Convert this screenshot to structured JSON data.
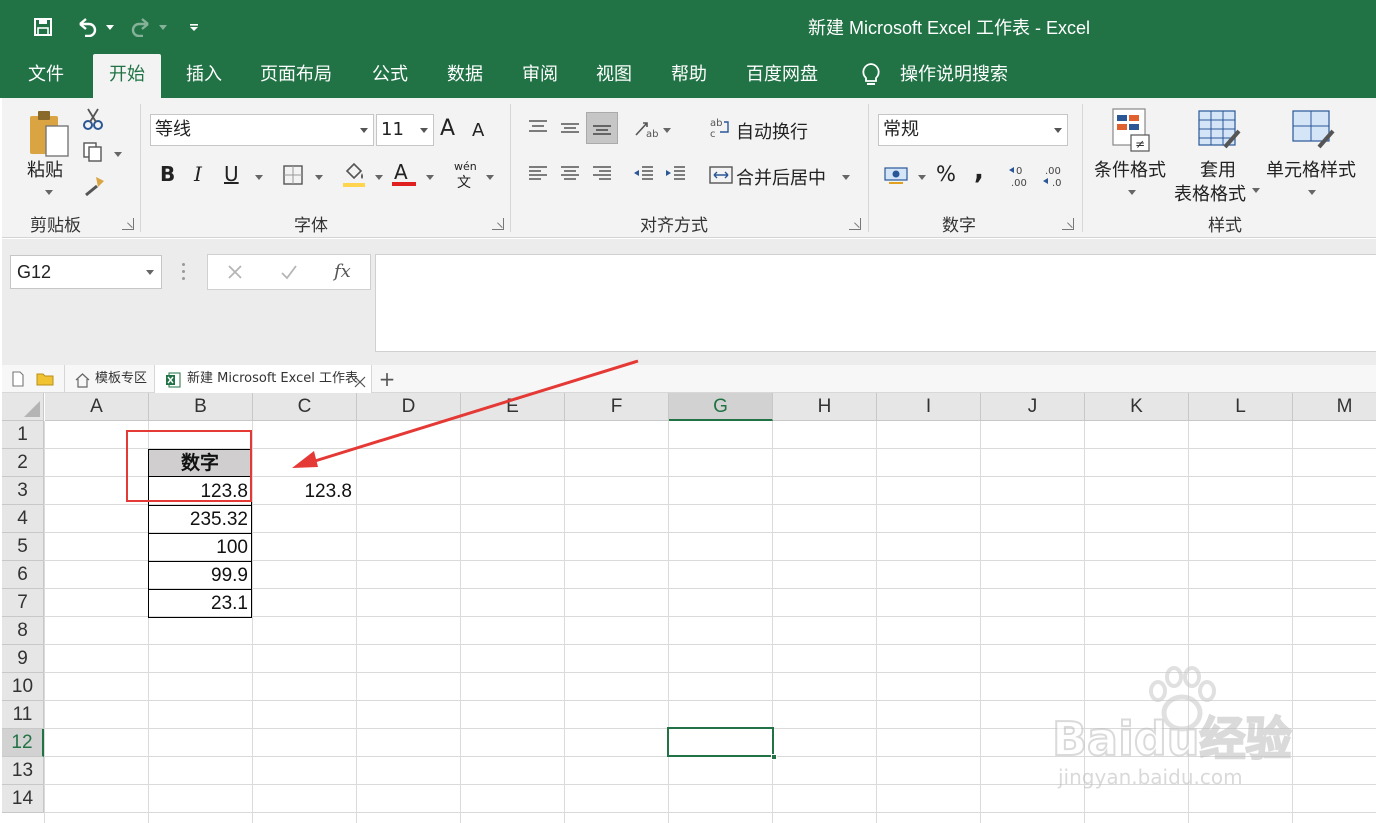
{
  "window": {
    "title": "新建 Microsoft Excel 工作表  -  Excel"
  },
  "quick_access": {
    "save_icon": "save-icon",
    "undo_icon": "undo-icon",
    "redo_icon": "redo-icon",
    "customize_icon": "customize-qat-icon"
  },
  "tabs": [
    "文件",
    "开始",
    "插入",
    "页面布局",
    "公式",
    "数据",
    "审阅",
    "视图",
    "帮助",
    "百度网盘"
  ],
  "tell_me": "操作说明搜索",
  "ribbon": {
    "clipboard": {
      "paste_label": "粘贴",
      "group_label": "剪贴板"
    },
    "font": {
      "font_name": "等线",
      "font_size": "11",
      "grow_label": "A",
      "shrink_label": "A",
      "bold": "B",
      "italic": "I",
      "underline": "U",
      "fill_icon": "fill-color-icon",
      "font_color_label": "A",
      "phonetic_top": "wén",
      "phonetic_bottom": "文",
      "group_label": "字体"
    },
    "alignment": {
      "wrap_text": "自动换行",
      "merge_center": "合并后居中",
      "group_label": "对齐方式"
    },
    "number": {
      "format": "常规",
      "percent": "%",
      "comma": ",",
      "increase_decimal": ".00",
      "decrease_decimal": ".00",
      "group_label": "数字"
    },
    "styles": {
      "conditional_format": "条件格式",
      "format_table_1": "套用",
      "format_table_2": "表格格式",
      "cell_styles": "单元格样式",
      "group_label": "样式"
    }
  },
  "formula_bar": {
    "name_box": "G12",
    "fx_label": "fx",
    "formula": ""
  },
  "doc_tabs": {
    "template_label": "模板专区",
    "file_label": "新建 Microsoft Excel 工作表",
    "add_label": "+"
  },
  "sheet": {
    "columns": [
      "A",
      "B",
      "C",
      "D",
      "E",
      "F",
      "G",
      "H",
      "I",
      "J",
      "K",
      "L",
      "M"
    ],
    "rows": [
      "1",
      "2",
      "3",
      "4",
      "5",
      "6",
      "7",
      "8",
      "9",
      "10",
      "11",
      "12",
      "13",
      "14"
    ],
    "selected_cell": "G12",
    "header_cell": "数字",
    "b_values": [
      "123.8",
      "235.32",
      "100",
      "99.9",
      "23.1"
    ],
    "c3_value": "123.8"
  },
  "watermark": {
    "brand": "Baidu经验",
    "url": "jingyan.baidu.com"
  },
  "colors": {
    "excel_green": "#217346",
    "annotation_red": "#e53935"
  }
}
